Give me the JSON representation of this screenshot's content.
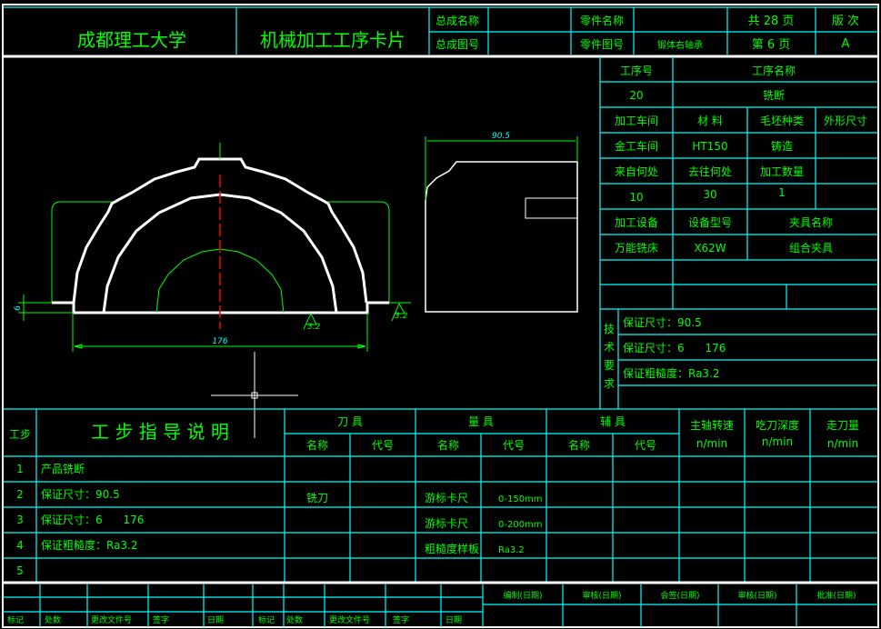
{
  "header": {
    "school": "成都理工大学",
    "card_title": "机械加工工序卡片",
    "assembly_name_label": "总成名称",
    "assembly_no_label": "总成图号",
    "part_name_label": "零件名称",
    "part_no_label": "零件图号",
    "part_no_value": "锻体右轴承",
    "total_pages": "共  28  页",
    "page_no": "第  6  页",
    "revision_label": "版 次",
    "revision_value": "A"
  },
  "process": {
    "op_no_label": "工序号",
    "op_name_label": "工序名称",
    "op_no": "20",
    "op_name": "铣断",
    "workshop_label": "加工车间",
    "material_label": "材  料",
    "blank_label": "毛坯种类",
    "size_label": "外形尺寸",
    "workshop": "金工车间",
    "material": "HT150",
    "blank": "铸造",
    "from_label": "来自何处",
    "to_label": "去往何处",
    "qty_label": "加工数量",
    "from": "10",
    "to": "30",
    "qty": "1",
    "equip_label": "加工设备",
    "model_label": "设备型号",
    "fixture_label": "夹具名称",
    "equip": "万能铣床",
    "model": "X62W",
    "fixture": "组合夹具"
  },
  "tech": {
    "label": [
      "技",
      "术",
      "要",
      "求"
    ],
    "items": [
      "保证尺寸：90.5",
      "保证尺寸：6      176",
      "保证粗糙度：Ra3.2"
    ]
  },
  "drawing": {
    "dim_width": "176",
    "dim_height": "6",
    "dim_side": "90.5",
    "roughness": "3.2"
  },
  "steps": {
    "step_label": "工步",
    "guide_label": "工 步 指 导 说 明",
    "tool_label": "刀 具",
    "gauge_label": "量 具",
    "aux_label": "辅 具",
    "name_label": "名称",
    "code_label": "代号",
    "speed_label": "主轴转速",
    "depth_label": "吃刀深度",
    "feed_label": "走刀量",
    "unit": "n/min",
    "rows": [
      {
        "no": "1",
        "desc": "产品铣断",
        "tool": "",
        "gauge": "",
        "gauge_code": ""
      },
      {
        "no": "2",
        "desc": "保证尺寸：90.5",
        "tool": "铣刀",
        "gauge": "游标卡尺",
        "gauge_code": "0-150mm"
      },
      {
        "no": "3",
        "desc": "保证尺寸：6      176",
        "tool": "",
        "gauge": "游标卡尺",
        "gauge_code": "0-200mm"
      },
      {
        "no": "4",
        "desc": "保证粗糙度：Ra3.2",
        "tool": "",
        "gauge": "粗糙度样板",
        "gauge_code": "Ra3.2"
      },
      {
        "no": "5",
        "desc": "",
        "tool": "",
        "gauge": "",
        "gauge_code": ""
      }
    ]
  },
  "footer": {
    "left": [
      "标记",
      "处数",
      "更改文件号",
      "签字",
      "日期",
      "标记",
      "处数",
      "更改文件号",
      "签字",
      "日期"
    ],
    "right": [
      "编制(日期)",
      "审核(日期)",
      "会签(日期)",
      "审核(日期)",
      "批准(日期)"
    ]
  }
}
